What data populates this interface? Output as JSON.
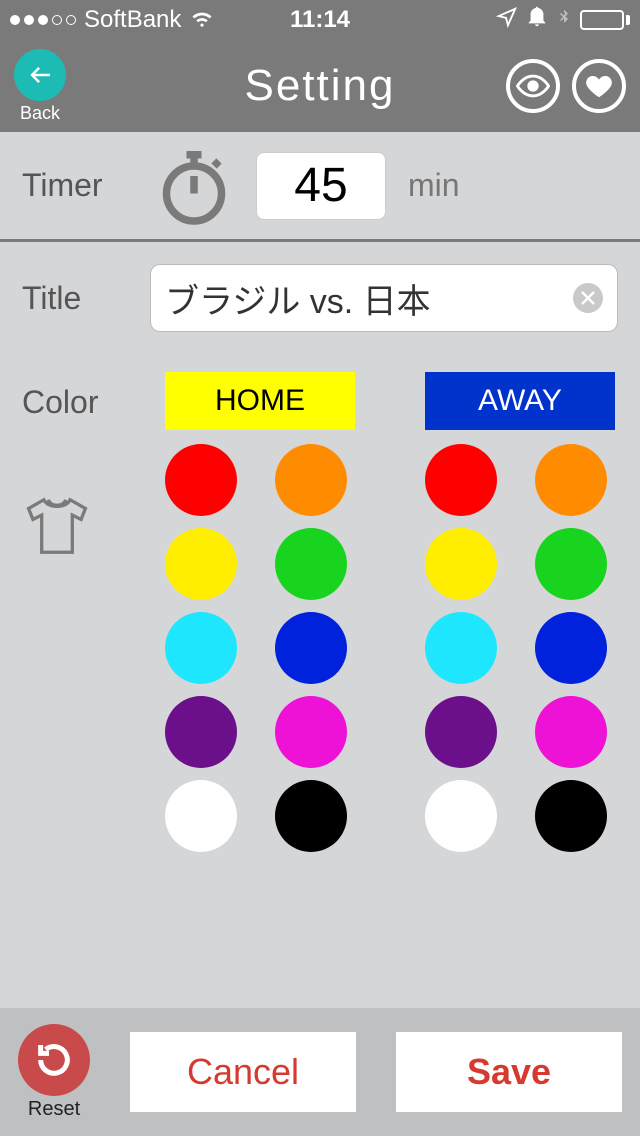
{
  "status": {
    "carrier": "SoftBank",
    "time": "11:14"
  },
  "nav": {
    "back_label": "Back",
    "title": "Setting"
  },
  "timer": {
    "label": "Timer",
    "value": "45",
    "unit": "min"
  },
  "title": {
    "label": "Title",
    "value": "ブラジル vs. 日本"
  },
  "color": {
    "label": "Color",
    "home_label": "HOME",
    "away_label": "AWAY",
    "swatches": [
      "#ff0000",
      "#ff8c00",
      "#ffee00",
      "#19d41f",
      "#1fe6ff",
      "#0022dd",
      "#6b0f8a",
      "#ee12d6",
      "#ffffff",
      "#000000"
    ]
  },
  "footer": {
    "reset_label": "Reset",
    "cancel_label": "Cancel",
    "save_label": "Save"
  }
}
